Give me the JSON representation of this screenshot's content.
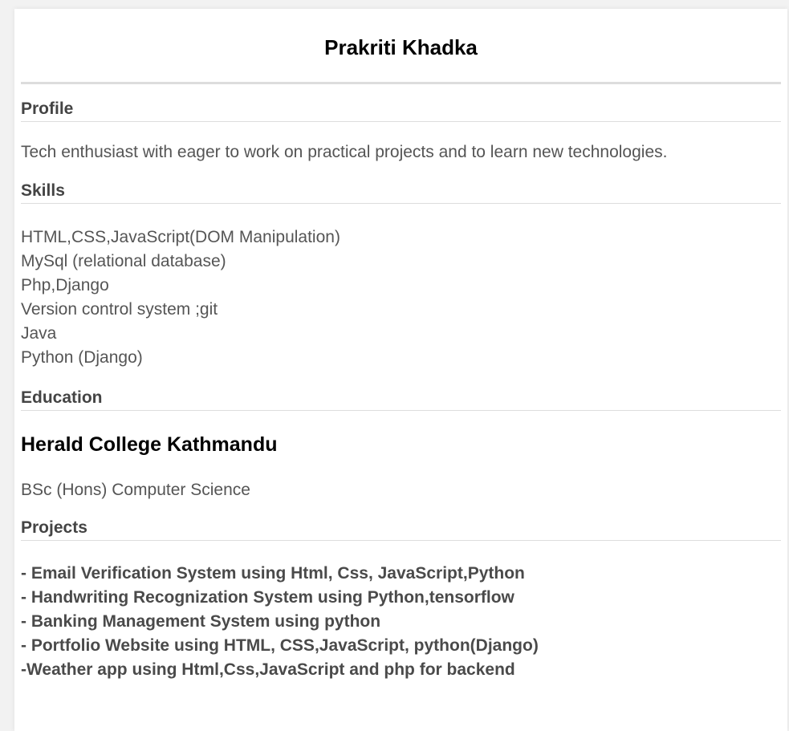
{
  "name": "Prakriti Khadka",
  "profile": {
    "heading": "Profile",
    "text": "Tech enthusiast with eager to work on practical projects and to learn new technologies."
  },
  "skills": {
    "heading": "Skills",
    "items": [
      "HTML,CSS,JavaScript(DOM Manipulation)",
      "MySql (relational database)",
      "Php,Django",
      "Version control system ;git",
      "Java",
      "Python (Django)"
    ]
  },
  "education": {
    "heading": "Education",
    "institution": "Herald College Kathmandu",
    "degree": "BSc (Hons) Computer Science"
  },
  "projects": {
    "heading": "Projects",
    "items": [
      "- Email Verification System using Html, Css, JavaScript,Python",
      "- Handwriting Recognization System using Python,tensorflow",
      "- Banking Management System using python",
      "- Portfolio Website using HTML, CSS,JavaScript, python(Django)",
      "-Weather app using Html,Css,JavaScript and php for backend"
    ]
  }
}
